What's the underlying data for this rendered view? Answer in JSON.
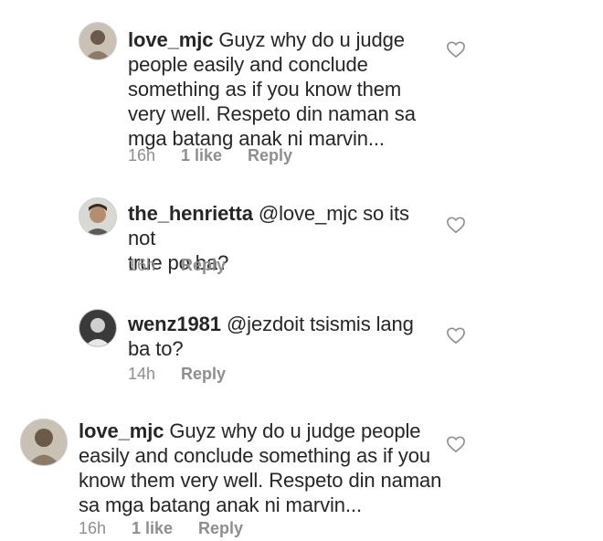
{
  "comments": [
    {
      "username": "love_mjc",
      "lines": [
        "Guyz why do u judge",
        "people easily and conclude",
        "something as if you know them",
        "very well. Respeto din naman sa",
        "mga batang anak ni marvin..."
      ],
      "time": "16h",
      "likes": "1 like",
      "reply": "Reply",
      "avatar_icon": "user-avatar-icon",
      "like_icon": "heart-icon"
    },
    {
      "username": "the_henrietta",
      "lines": [
        "@love_mjc so its not",
        "true po ba?"
      ],
      "time": "16h",
      "likes": "",
      "reply": "Reply",
      "avatar_icon": "user-avatar-icon",
      "like_icon": "heart-icon"
    },
    {
      "username": "wenz1981",
      "lines": [
        "@jezdoit tsismis lang",
        "ba to?"
      ],
      "time": "14h",
      "likes": "",
      "reply": "Reply",
      "avatar_icon": "user-avatar-icon",
      "like_icon": "heart-icon"
    },
    {
      "username": "love_mjc",
      "lines": [
        "Guyz why do u judge people",
        "easily and conclude something as if you",
        "know them very well. Respeto din naman",
        "sa mga batang anak ni marvin..."
      ],
      "time": "16h",
      "likes": "1 like",
      "reply": "Reply",
      "avatar_icon": "user-avatar-icon",
      "like_icon": "heart-icon"
    }
  ],
  "colors": {
    "text": "#262626",
    "meta": "#8e8e8e"
  }
}
